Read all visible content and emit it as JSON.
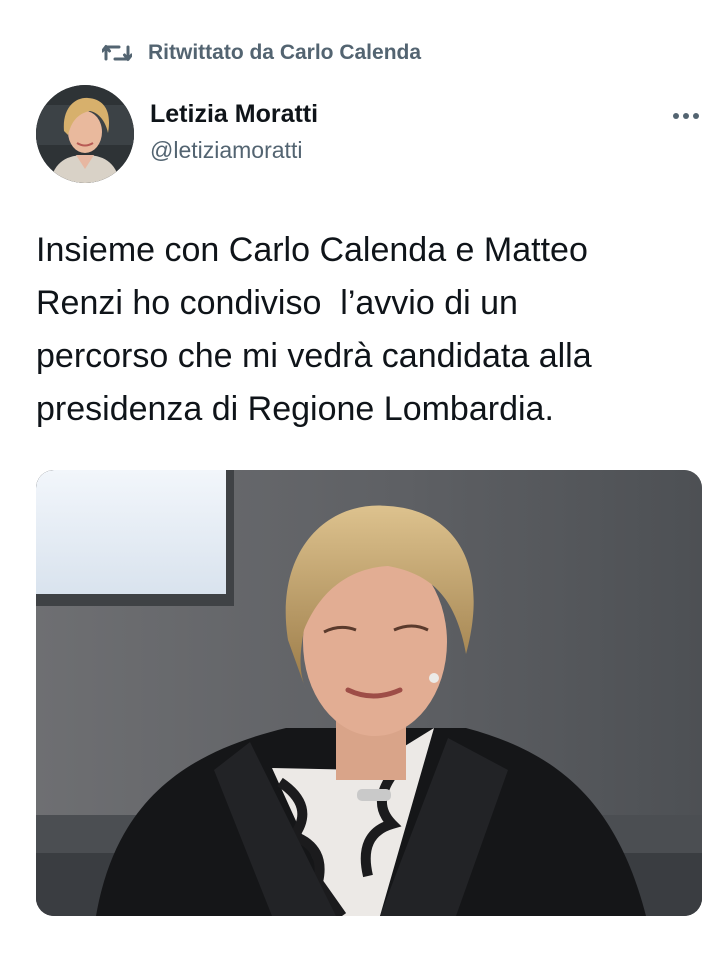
{
  "retweet": {
    "icon": "retweet-icon",
    "text": "Ritwittato da Carlo Calenda"
  },
  "author": {
    "name": "Letizia Moratti",
    "handle": "@letiziamoratti",
    "avatar": "avatar-photo"
  },
  "more_icon": "more-icon",
  "tweet": {
    "text": "Insieme con Carlo Calenda e Matteo\nRenzi ho condiviso  l’avvio di un\npercorso che mi vedrà candidata alla\npresidenza di Regione Lombardia."
  },
  "media": {
    "kind": "photo"
  },
  "colors": {
    "text_primary": "#0f1419",
    "text_secondary": "#536471",
    "background": "#ffffff"
  }
}
